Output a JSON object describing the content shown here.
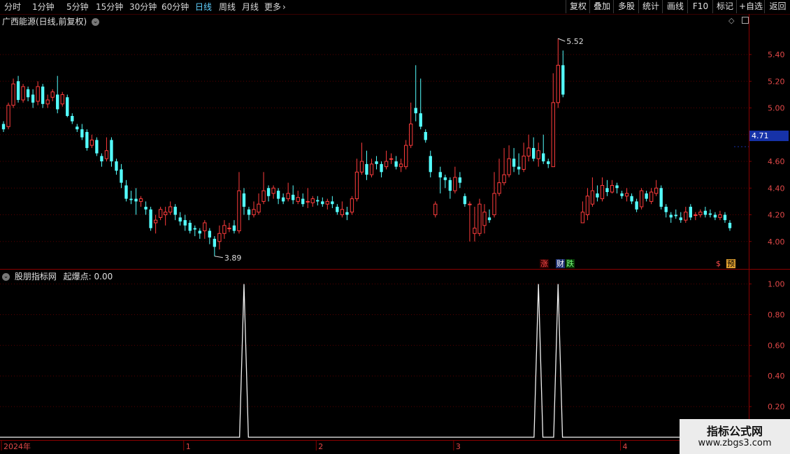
{
  "toolbar": {
    "period_tabs": [
      "分时",
      "1分钟",
      "5分钟",
      "15分钟",
      "30分钟",
      "60分钟",
      "日线",
      "周线",
      "月线",
      "更多"
    ],
    "active_tab": "日线",
    "right_buttons": [
      "复权",
      "叠加",
      "多股",
      "统计",
      "画线",
      "F10",
      "标记",
      "+自选",
      "返回"
    ]
  },
  "main_panel": {
    "stock_title": "广西能源(日线,前复权)",
    "current_price_label": "4.71",
    "high_annotation": "5.52",
    "low_annotation": "3.89",
    "event_marks": [
      "涨",
      "财",
      "跌",
      "预"
    ],
    "colors": {
      "up": "#ff3c3c",
      "down": "#54ffff",
      "grid": "#5a0000",
      "axis_text": "#e24848",
      "price_box": "#1632a8"
    }
  },
  "indicator_panel": {
    "title": "股朋指标网",
    "param_label": "起爆点: 0.00"
  },
  "x_axis": {
    "labels": [
      "2024年",
      "1",
      "2",
      "3",
      "4",
      "5"
    ]
  },
  "watermark": {
    "line1": "指标公式网",
    "line2": "www.zbgs3.com"
  },
  "chart_data": [
    {
      "type": "candlestick",
      "title": "广西能源(日线,前复权)",
      "y_ticks": [
        5.4,
        5.2,
        5.0,
        4.8,
        4.6,
        4.4,
        4.2,
        4.0
      ],
      "ylim": [
        3.8,
        5.62
      ],
      "annotations": {
        "high": 5.52,
        "low": 3.89,
        "last": 4.71
      },
      "x_month_labels": [
        "2024年",
        "1",
        "2",
        "3",
        "4",
        "5"
      ],
      "candles": [
        [
          4.88,
          4.84,
          4.9,
          4.82
        ],
        [
          4.86,
          5.02,
          5.04,
          4.84
        ],
        [
          5.02,
          5.18,
          5.22,
          5.0
        ],
        [
          5.2,
          5.06,
          5.24,
          5.04
        ],
        [
          5.06,
          5.16,
          5.18,
          5.04
        ],
        [
          5.14,
          5.08,
          5.16,
          5.05
        ],
        [
          5.1,
          5.04,
          5.14,
          5.0
        ],
        [
          5.05,
          5.16,
          5.2,
          5.02
        ],
        [
          5.16,
          5.03,
          5.18,
          5.0
        ],
        [
          5.03,
          5.06,
          5.1,
          5.0
        ],
        [
          5.08,
          5.12,
          5.14,
          5.05
        ],
        [
          5.1,
          4.99,
          5.24,
          4.96
        ],
        [
          5.03,
          5.1,
          5.12,
          5.01
        ],
        [
          5.08,
          4.94,
          5.1,
          4.93
        ],
        [
          4.94,
          4.9,
          4.96,
          4.88
        ],
        [
          4.86,
          4.84,
          4.88,
          4.82
        ],
        [
          4.84,
          4.78,
          4.88,
          4.76
        ],
        [
          4.82,
          4.7,
          4.84,
          4.68
        ],
        [
          4.72,
          4.76,
          4.8,
          4.7
        ],
        [
          4.76,
          4.66,
          4.78,
          4.64
        ],
        [
          4.64,
          4.6,
          4.66,
          4.56
        ],
        [
          4.62,
          4.68,
          4.78,
          4.6
        ],
        [
          4.76,
          4.6,
          4.78,
          4.56
        ],
        [
          4.6,
          4.53,
          4.62,
          4.5
        ],
        [
          4.54,
          4.44,
          4.58,
          4.4
        ],
        [
          4.42,
          4.32,
          4.46,
          4.3
        ],
        [
          4.32,
          4.31,
          4.38,
          4.28
        ],
        [
          4.32,
          4.3,
          4.4,
          4.2
        ],
        [
          4.3,
          4.32,
          4.34,
          4.26
        ],
        [
          4.26,
          4.24,
          4.3,
          4.2
        ],
        [
          4.24,
          4.1,
          4.26,
          4.08
        ],
        [
          4.14,
          4.16,
          4.2,
          4.06
        ],
        [
          4.18,
          4.24,
          4.26,
          4.16
        ],
        [
          4.2,
          4.22,
          4.26,
          4.12
        ],
        [
          4.22,
          4.26,
          4.3,
          4.2
        ],
        [
          4.26,
          4.2,
          4.28,
          4.16
        ],
        [
          4.18,
          4.15,
          4.22,
          4.12
        ],
        [
          4.16,
          4.12,
          4.2,
          4.08
        ],
        [
          4.14,
          4.08,
          4.16,
          4.06
        ],
        [
          4.1,
          4.09,
          4.12,
          4.04
        ],
        [
          4.08,
          4.06,
          4.1,
          4.02
        ],
        [
          4.08,
          4.14,
          4.16,
          4.02
        ],
        [
          4.08,
          4.03,
          4.1,
          3.98
        ],
        [
          4.02,
          3.96,
          4.04,
          3.89
        ],
        [
          4.0,
          4.06,
          4.12,
          3.94
        ],
        [
          4.06,
          4.12,
          4.16,
          4.02
        ],
        [
          4.1,
          4.1,
          4.14,
          4.07
        ],
        [
          4.12,
          4.08,
          4.16,
          4.06
        ],
        [
          4.08,
          4.38,
          4.52,
          4.06
        ],
        [
          4.36,
          4.26,
          4.4,
          4.2
        ],
        [
          4.24,
          4.2,
          4.26,
          4.16
        ],
        [
          4.2,
          4.24,
          4.3,
          4.18
        ],
        [
          4.22,
          4.28,
          4.36,
          4.2
        ],
        [
          4.3,
          4.38,
          4.52,
          4.28
        ],
        [
          4.4,
          4.34,
          4.42,
          4.3
        ],
        [
          4.36,
          4.4,
          4.42,
          4.32
        ],
        [
          4.38,
          4.32,
          4.4,
          4.28
        ],
        [
          4.33,
          4.3,
          4.36,
          4.28
        ],
        [
          4.32,
          4.36,
          4.44,
          4.3
        ],
        [
          4.35,
          4.31,
          4.42,
          4.28
        ],
        [
          4.3,
          4.33,
          4.38,
          4.28
        ],
        [
          4.32,
          4.28,
          4.36,
          4.26
        ],
        [
          4.3,
          4.3,
          4.4,
          4.25
        ],
        [
          4.29,
          4.32,
          4.34,
          4.26
        ],
        [
          4.31,
          4.3,
          4.34,
          4.27
        ],
        [
          4.3,
          4.28,
          4.33,
          4.26
        ],
        [
          4.28,
          4.3,
          4.32,
          4.24
        ],
        [
          4.3,
          4.28,
          4.34,
          4.25
        ],
        [
          4.26,
          4.22,
          4.28,
          4.2
        ],
        [
          4.2,
          4.24,
          4.3,
          4.18
        ],
        [
          4.22,
          4.2,
          4.26,
          4.16
        ],
        [
          4.22,
          4.32,
          4.34,
          4.2
        ],
        [
          4.32,
          4.52,
          4.62,
          4.3
        ],
        [
          4.52,
          4.6,
          4.74,
          4.5
        ],
        [
          4.58,
          4.5,
          4.68,
          4.46
        ],
        [
          4.5,
          4.58,
          4.62,
          4.48
        ],
        [
          4.6,
          4.58,
          4.64,
          4.54
        ],
        [
          4.58,
          4.52,
          4.6,
          4.48
        ],
        [
          4.56,
          4.6,
          4.68,
          4.54
        ],
        [
          4.62,
          4.62,
          4.66,
          4.58
        ],
        [
          4.6,
          4.56,
          4.64,
          4.54
        ],
        [
          4.56,
          4.58,
          4.62,
          4.52
        ],
        [
          4.56,
          4.72,
          4.76,
          4.54
        ],
        [
          4.72,
          4.88,
          5.04,
          4.7
        ],
        [
          5.0,
          4.96,
          5.32,
          4.9
        ],
        [
          4.96,
          4.86,
          5.22,
          4.84
        ],
        [
          4.82,
          4.76,
          4.84,
          4.74
        ],
        [
          4.64,
          4.52,
          4.68,
          4.48
        ],
        [
          4.2,
          4.28,
          4.3,
          4.18
        ],
        [
          4.52,
          4.48,
          4.56,
          4.36
        ],
        [
          4.48,
          4.46,
          4.5,
          4.4
        ],
        [
          4.46,
          4.38,
          4.48,
          4.32
        ],
        [
          4.38,
          4.48,
          4.56,
          4.36
        ],
        [
          4.48,
          4.44,
          4.52,
          4.4
        ],
        [
          4.34,
          4.28,
          4.36,
          4.26
        ],
        [
          4.28,
          4.28,
          4.3,
          4.0
        ],
        [
          4.06,
          4.1,
          4.26,
          4.0
        ],
        [
          4.06,
          4.28,
          4.32,
          4.04
        ],
        [
          4.12,
          4.22,
          4.28,
          4.06
        ],
        [
          4.18,
          4.16,
          4.24,
          4.14
        ],
        [
          4.2,
          4.36,
          4.52,
          4.18
        ],
        [
          4.36,
          4.44,
          4.62,
          4.34
        ],
        [
          4.44,
          4.5,
          4.7,
          4.42
        ],
        [
          4.5,
          4.62,
          4.72,
          4.48
        ],
        [
          4.62,
          4.56,
          4.7,
          4.52
        ],
        [
          4.56,
          4.54,
          4.66,
          4.5
        ],
        [
          4.54,
          4.64,
          4.74,
          4.52
        ],
        [
          4.64,
          4.7,
          4.8,
          4.6
        ],
        [
          4.7,
          4.62,
          4.78,
          4.6
        ],
        [
          4.62,
          4.68,
          4.74,
          4.56
        ],
        [
          4.66,
          4.6,
          4.8,
          4.58
        ],
        [
          4.6,
          4.58,
          4.62,
          4.55
        ],
        [
          4.56,
          5.04,
          5.26,
          4.56
        ],
        [
          5.04,
          5.32,
          5.52,
          5.0
        ],
        [
          5.32,
          5.1,
          5.43,
          5.08
        ],
        [
          null,
          null,
          null,
          null
        ],
        [
          null,
          null,
          null,
          null
        ],
        [
          null,
          null,
          null,
          null
        ],
        [
          4.14,
          4.22,
          4.3,
          4.14
        ],
        [
          4.2,
          4.34,
          4.4,
          4.16
        ],
        [
          4.28,
          4.38,
          4.48,
          4.26
        ],
        [
          4.36,
          4.33,
          4.42,
          4.3
        ],
        [
          4.32,
          4.42,
          4.48,
          4.3
        ],
        [
          4.4,
          4.37,
          4.46,
          4.34
        ],
        [
          4.37,
          4.42,
          4.46,
          4.36
        ],
        [
          4.42,
          4.4,
          4.44,
          4.36
        ],
        [
          4.36,
          4.34,
          4.38,
          4.32
        ],
        [
          4.34,
          4.36,
          4.4,
          4.3
        ],
        [
          4.34,
          4.3,
          4.36,
          4.28
        ],
        [
          4.3,
          4.24,
          4.32,
          4.22
        ],
        [
          4.26,
          4.38,
          4.4,
          4.24
        ],
        [
          4.36,
          4.32,
          4.38,
          4.3
        ],
        [
          4.3,
          4.37,
          4.4,
          4.28
        ],
        [
          4.36,
          4.4,
          4.46,
          4.34
        ],
        [
          4.4,
          4.26,
          4.42,
          4.24
        ],
        [
          4.26,
          4.22,
          4.28,
          4.18
        ],
        [
          4.2,
          4.18,
          4.22,
          4.14
        ],
        [
          4.2,
          4.19,
          4.24,
          4.17
        ],
        [
          4.18,
          4.16,
          4.22,
          4.14
        ],
        [
          4.16,
          4.22,
          4.26,
          4.14
        ],
        [
          4.26,
          4.18,
          4.28,
          4.16
        ],
        [
          4.2,
          4.2,
          4.22,
          4.16
        ],
        [
          4.2,
          4.22,
          4.24,
          4.18
        ],
        [
          4.23,
          4.2,
          4.26,
          4.18
        ],
        [
          4.21,
          4.2,
          4.24,
          4.18
        ],
        [
          4.2,
          4.18,
          4.22,
          4.16
        ],
        [
          4.18,
          4.2,
          4.23,
          4.16
        ],
        [
          4.2,
          4.16,
          4.22,
          4.14
        ],
        [
          4.14,
          4.1,
          4.16,
          4.08
        ]
      ]
    },
    {
      "type": "line",
      "title": "股朋指标网",
      "y_ticks": [
        1.0,
        0.8,
        0.6,
        0.4,
        0.2
      ],
      "ylim": [
        0,
        1.03
      ],
      "series": [
        {
          "name": "起爆点",
          "spikes_at_candle_index": [
            49,
            109,
            113
          ],
          "spike_value": 1.0,
          "baseline": 0.0
        }
      ]
    }
  ]
}
